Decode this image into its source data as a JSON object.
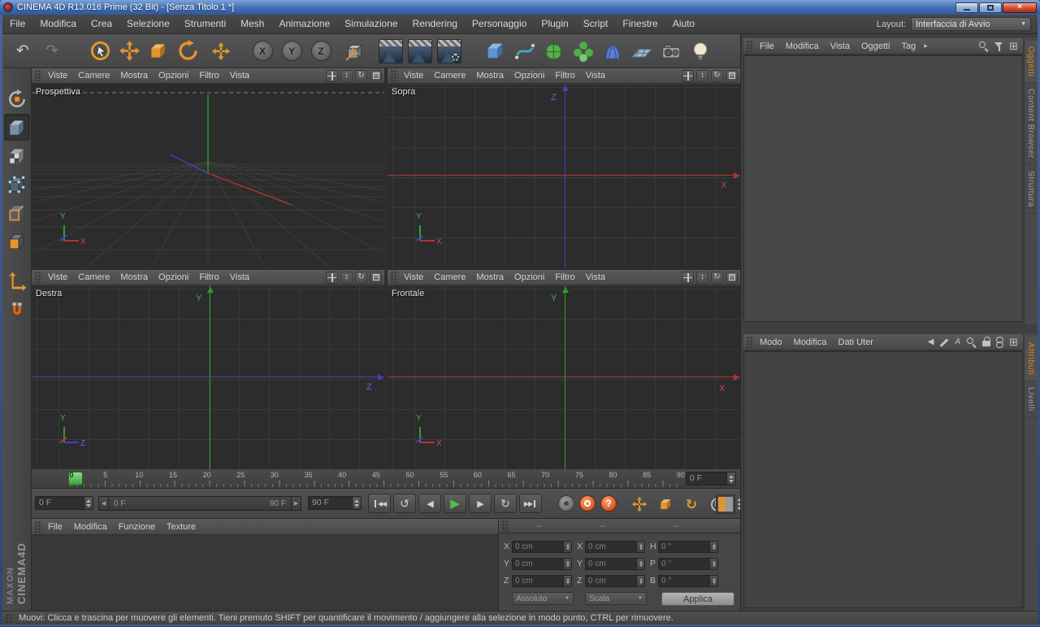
{
  "window": {
    "title": "CINEMA 4D R13.016 Prime (32 Bit) - [Senza Titolo 1 *]"
  },
  "menubar": {
    "items": [
      "File",
      "Modifica",
      "Crea",
      "Selezione",
      "Strumenti",
      "Mesh",
      "Animazione",
      "Simulazione",
      "Rendering",
      "Personaggio",
      "Plugin",
      "Script",
      "Finestre",
      "Aiuto"
    ],
    "layout_label": "Layout:",
    "layout_value": "Interfaccia di Avvio"
  },
  "toolbar": {
    "axis_locks": [
      "X",
      "Y",
      "Z"
    ]
  },
  "viewport_menu": [
    "Viste",
    "Camere",
    "Mostra",
    "Opzioni",
    "Filtro",
    "Vista"
  ],
  "viewports": [
    {
      "name": "Prospettiva",
      "gizmo_v": "Y",
      "gizmo_h": "X"
    },
    {
      "name": "Sopra",
      "v_axis": "Z",
      "h_axis": "X",
      "gizmo_v": "Y",
      "gizmo_h": "X"
    },
    {
      "name": "Destra",
      "v_axis": "Y",
      "h_axis": "Z",
      "gizmo_v": "Y",
      "gizmo_h": "Z"
    },
    {
      "name": "Frontale",
      "v_axis": "Y",
      "h_axis": "X",
      "gizmo_v": "Y",
      "gizmo_h": "X"
    }
  ],
  "timeline": {
    "ticks": [
      "0",
      "5",
      "10",
      "15",
      "20",
      "25",
      "30",
      "35",
      "40",
      "45",
      "50",
      "55",
      "60",
      "65",
      "70",
      "75",
      "80",
      "85",
      "90"
    ],
    "current_frame": "0 F"
  },
  "transport": {
    "frame_value": "0 F",
    "range_start": "0 F",
    "range_end": "90 F",
    "end_value": "90 F",
    "param_label": "P",
    "help_glyph": "?"
  },
  "materials": {
    "menu": [
      "File",
      "Modifica",
      "Funzione",
      "Texture"
    ]
  },
  "coordinates": {
    "header_cols": [
      "--",
      "--",
      "--"
    ],
    "rows": [
      {
        "l1": "X",
        "v1": "0 cm",
        "l2": "X",
        "v2": "0 cm",
        "l3": "H",
        "v3": "0 °"
      },
      {
        "l1": "Y",
        "v1": "0 cm",
        "l2": "Y",
        "v2": "0 cm",
        "l3": "P",
        "v3": "0 °"
      },
      {
        "l1": "Z",
        "v1": "0 cm",
        "l2": "Z",
        "v2": "0 cm",
        "l3": "B",
        "v3": "0 °"
      }
    ],
    "mode_value": "Assoluto",
    "scale_value": "Scala",
    "apply_label": "Applica"
  },
  "object_manager": {
    "menu": [
      "File",
      "Modifica",
      "Vista",
      "Oggetti",
      "Tag"
    ],
    "tabs": [
      "Oggetti",
      "Content Browser",
      "Struttura"
    ]
  },
  "attribute_manager": {
    "menu": [
      "Modo",
      "Modifica",
      "Dati Uter"
    ],
    "tabs": [
      "Attributi",
      "Livelli"
    ]
  },
  "statusbar": {
    "text": "Muovi: Clicca e trascina per muovere gli elementi. Tieni premuto SHIFT per quantificare il movimento / aggiungere alla selezione in modo punto, CTRL per rimuovere."
  },
  "branding": {
    "company": "MAXON",
    "product": "CINEMA4D"
  },
  "icons": {
    "undo": "↶",
    "redo": "↷",
    "goto_start": "◀◀",
    "prev_key": "↺",
    "prev_frame": "◀",
    "play": "▶",
    "next_frame": "▶",
    "next_key": "↻",
    "goto_end": "▶▶",
    "zoom": "↕",
    "rotate": "↻",
    "menu_overflow": "▸",
    "dropdown": "▼",
    "back": "◀",
    "pointer": "A",
    "panel_menu": "⊞",
    "close": "×"
  },
  "colors": {
    "accent_orange": "#e2952f",
    "play_green": "#4ec24e",
    "axis_red": "#ae3636",
    "axis_green": "#2f9e2f",
    "axis_blue": "#4343bd",
    "playhead_green": "#5fc45f",
    "active_tab_orange": "#d2871c"
  }
}
